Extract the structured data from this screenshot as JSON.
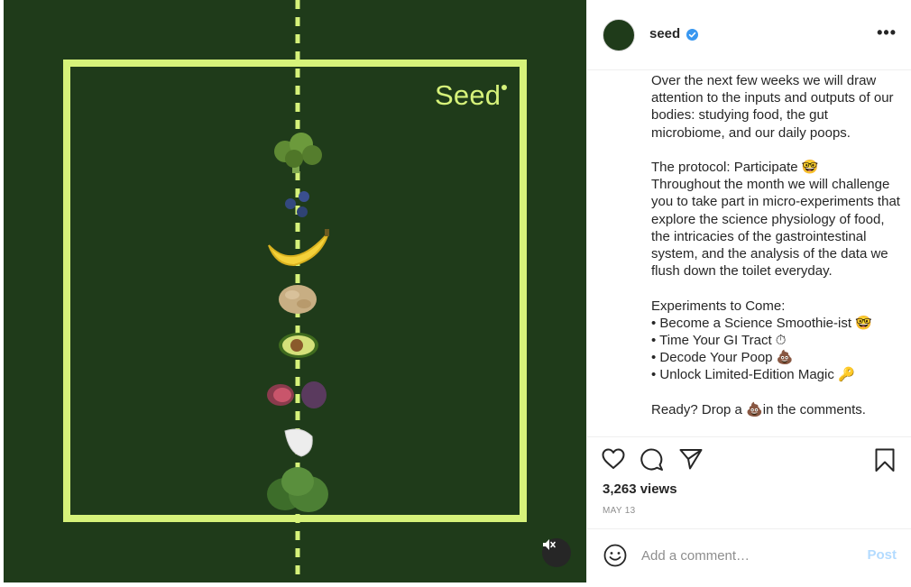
{
  "post": {
    "brand_text": "Seed",
    "media_icons": [
      "broccoli",
      "blueberries",
      "banana",
      "lentils",
      "avocado",
      "figs",
      "garlic",
      "spinach"
    ]
  },
  "account": {
    "username": "seed",
    "verified": true
  },
  "caption": {
    "lines": [
      "Over the next few weeks we will draw attention to the inputs and outputs of our bodies: studying food, the gut microbiome, and our daily poops.",
      "",
      "The protocol: Participate 🤓",
      "Throughout the month we will challenge you to take part in micro-experiments that explore the science physiology of food, the intricacies of the gastrointestinal system, and the analysis of the data we flush down the toilet everyday.",
      "",
      "Experiments to Come:",
      "• Become a Science Smoothie-ist 🤓",
      "• Time Your GI Tract ⏱",
      "• Decode Your Poop 💩",
      "• Unlock Limited-Edition Magic 🔑",
      "",
      "Ready? Drop a 💩in the comments."
    ]
  },
  "stats": {
    "views": "3,263 views",
    "date": "MAY 13"
  },
  "comment": {
    "placeholder": "Add a comment…",
    "post_label": "Post"
  },
  "colors": {
    "media_bg": "#1f3b1a",
    "accent_lime": "#d6f27a",
    "verified_blue": "#3897f0",
    "post_disabled": "#b3dbff"
  }
}
